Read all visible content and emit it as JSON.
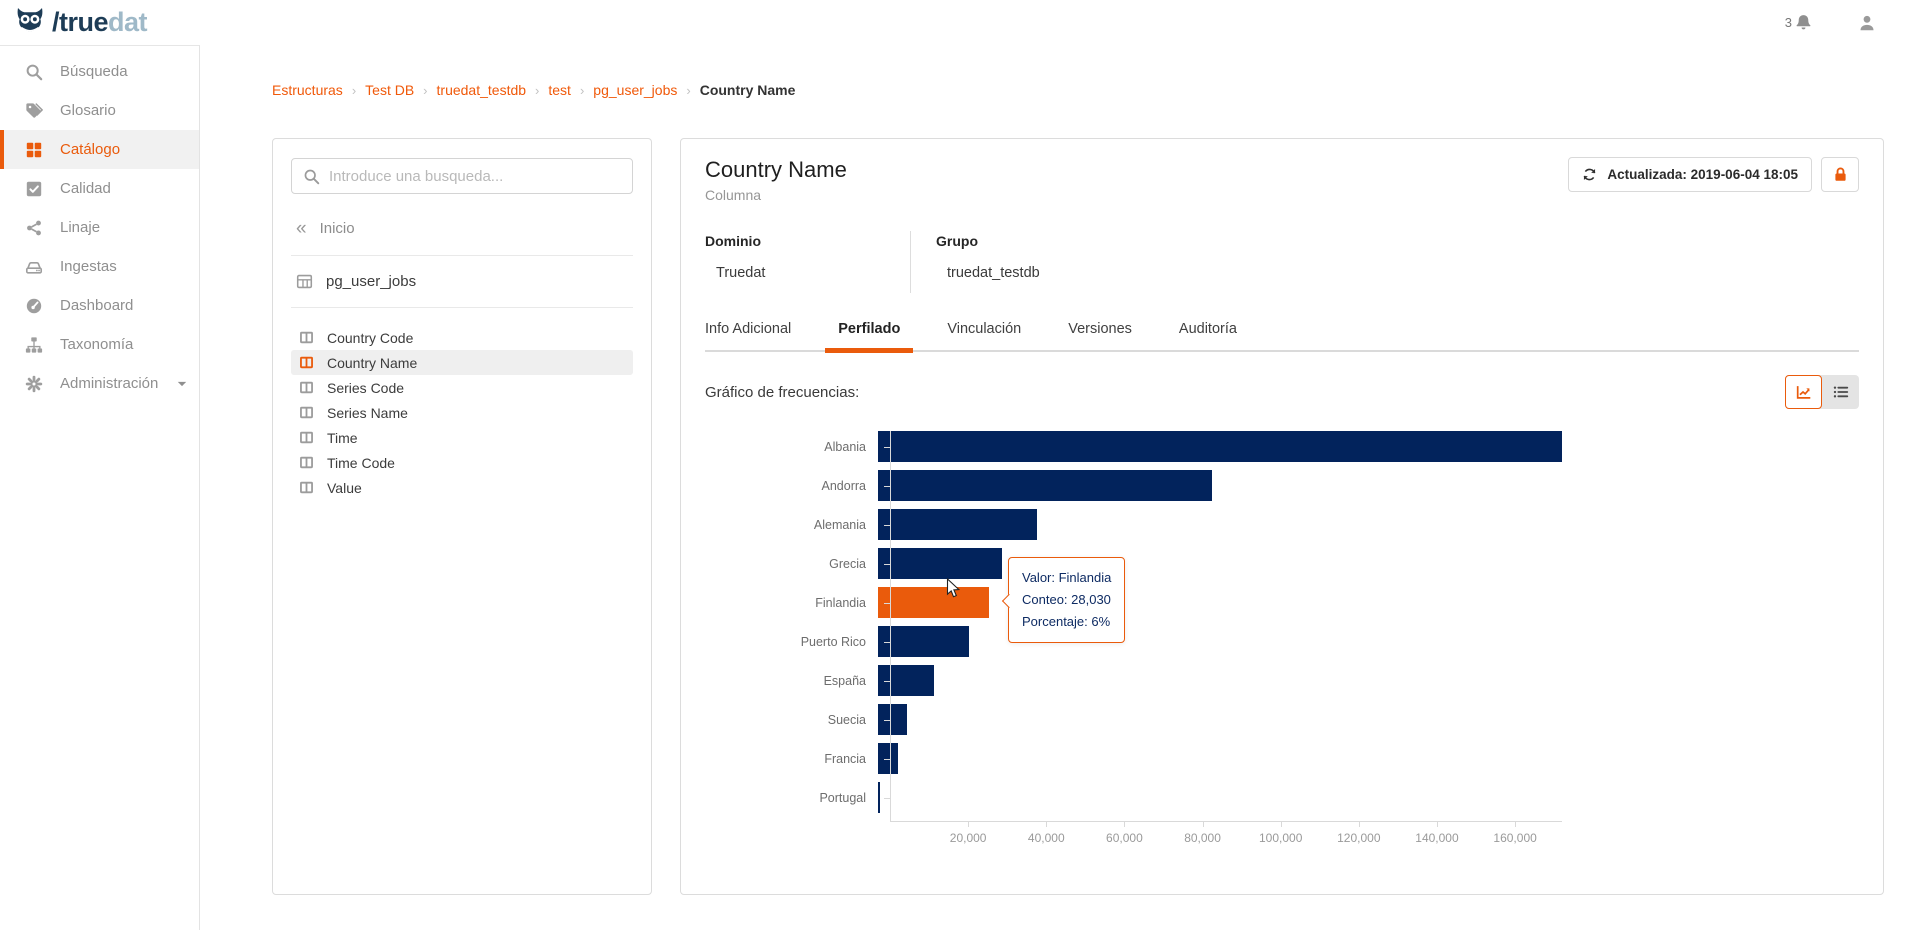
{
  "header": {
    "logo_primary": "/true",
    "logo_secondary": "dat",
    "notification_count": "3"
  },
  "sidebar": {
    "items": [
      {
        "name": "busqueda",
        "label": "Búsqueda",
        "icon": "search-icon"
      },
      {
        "name": "glosario",
        "label": "Glosario",
        "icon": "tags-icon"
      },
      {
        "name": "catalogo",
        "label": "Catálogo",
        "icon": "grid-icon",
        "active": true
      },
      {
        "name": "calidad",
        "label": "Calidad",
        "icon": "check-square-icon"
      },
      {
        "name": "linaje",
        "label": "Linaje",
        "icon": "share-icon"
      },
      {
        "name": "ingestas",
        "label": "Ingestas",
        "icon": "drive-icon"
      },
      {
        "name": "dashboard",
        "label": "Dashboard",
        "icon": "gauge-icon"
      },
      {
        "name": "taxonomia",
        "label": "Taxonomía",
        "icon": "sitemap-icon"
      },
      {
        "name": "administracion",
        "label": "Administración",
        "icon": "gear-icon",
        "expandable": true
      }
    ]
  },
  "breadcrumb": {
    "links": [
      "Estructuras",
      "Test DB",
      "truedat_testdb",
      "test",
      "pg_user_jobs"
    ],
    "current": "Country Name"
  },
  "browser_panel": {
    "search_placeholder": "Introduce una busqueda...",
    "back_label": "Inicio",
    "table_name": "pg_user_jobs",
    "columns": [
      "Country Code",
      "Country Name",
      "Series Code",
      "Series Name",
      "Time",
      "Time Code",
      "Value"
    ],
    "selected_column": "Country Name"
  },
  "detail": {
    "title": "Country Name",
    "subtitle": "Columna",
    "updated_label": "Actualizada: 2019-06-04 18:05",
    "meta": [
      {
        "label": "Dominio",
        "value": "Truedat"
      },
      {
        "label": "Grupo",
        "value": "truedat_testdb"
      }
    ],
    "tabs": [
      "Info Adicional",
      "Perfilado",
      "Vinculación",
      "Versiones",
      "Auditoría"
    ],
    "active_tab": "Perfilado",
    "chart_heading": "Gráfico de frecuencias:"
  },
  "tooltip": {
    "lines": [
      "Valor: Finlandia",
      "Conteo: 28,030",
      "Porcentaje: 6%"
    ]
  },
  "chart_data": {
    "type": "bar",
    "orientation": "horizontal",
    "title": "Gráfico de frecuencias:",
    "categories": [
      "Albania",
      "Andorra",
      "Alemania",
      "Grecia",
      "Finlandia",
      "Puerto Rico",
      "España",
      "Suecia",
      "Francia",
      "Portugal"
    ],
    "values": [
      172000,
      84000,
      40000,
      31200,
      28030,
      23000,
      14000,
      7200,
      5000,
      500
    ],
    "value_note": "values estimated from pixel widths; Finlandia exact (tooltip: 28,030 = 6%)",
    "highlight_category": "Finlandia",
    "xticks": [
      20000,
      40000,
      60000,
      80000,
      100000,
      120000,
      140000,
      160000
    ],
    "xtick_labels": [
      "20,000",
      "40,000",
      "60,000",
      "80,000",
      "100,000",
      "120,000",
      "140,000",
      "160,000"
    ],
    "xlim": [
      0,
      172000
    ],
    "grid": false,
    "legend": "none",
    "bar_color": "#02235c",
    "highlight_color": "#ea5b0c"
  }
}
